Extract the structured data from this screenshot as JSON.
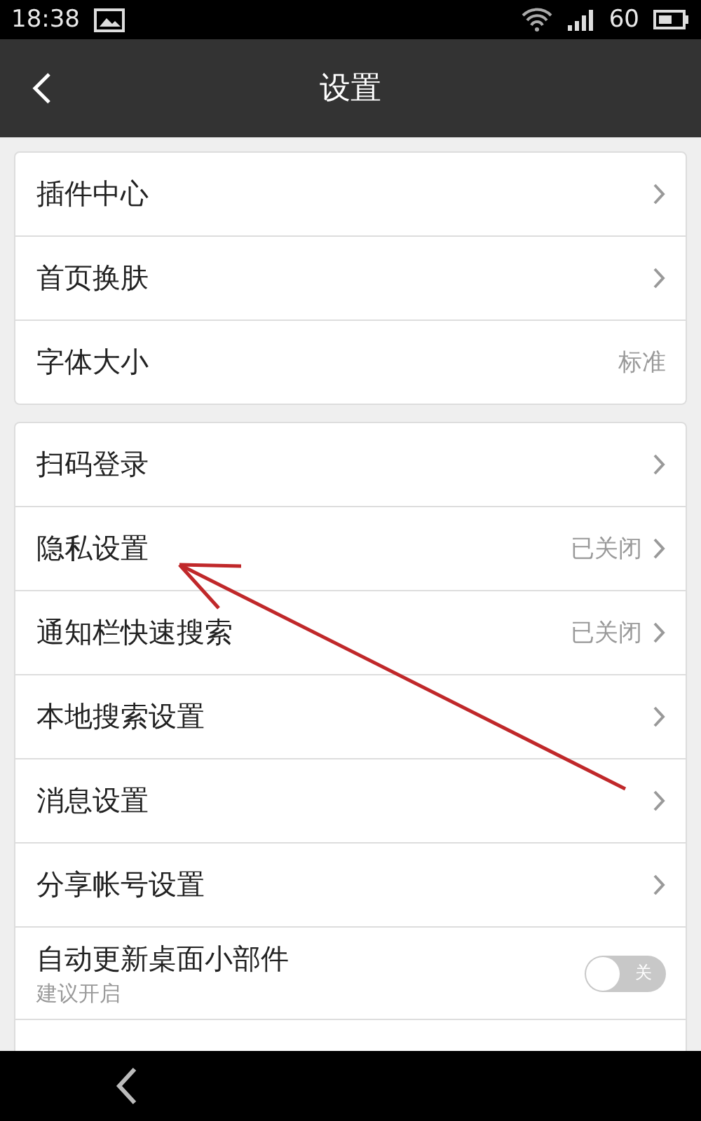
{
  "status_bar": {
    "time": "18:38",
    "battery": "60"
  },
  "header": {
    "title": "设置"
  },
  "groups": [
    {
      "items": [
        {
          "kind": "link",
          "label": "插件中心"
        },
        {
          "kind": "link",
          "label": "首页换肤"
        },
        {
          "kind": "value",
          "label": "字体大小",
          "value": "标准"
        }
      ]
    },
    {
      "items": [
        {
          "kind": "link",
          "label": "扫码登录"
        },
        {
          "kind": "link",
          "label": "隐私设置",
          "value": "已关闭"
        },
        {
          "kind": "link",
          "label": "通知栏快速搜索",
          "value": "已关闭"
        },
        {
          "kind": "link",
          "label": "本地搜索设置"
        },
        {
          "kind": "link",
          "label": "消息设置"
        },
        {
          "kind": "link",
          "label": "分享帐号设置"
        },
        {
          "kind": "switch",
          "label": "自动更新桌面小部件",
          "hint": "建议开启",
          "on": false,
          "switch_text": "关"
        },
        {
          "kind": "cut"
        }
      ]
    }
  ]
}
